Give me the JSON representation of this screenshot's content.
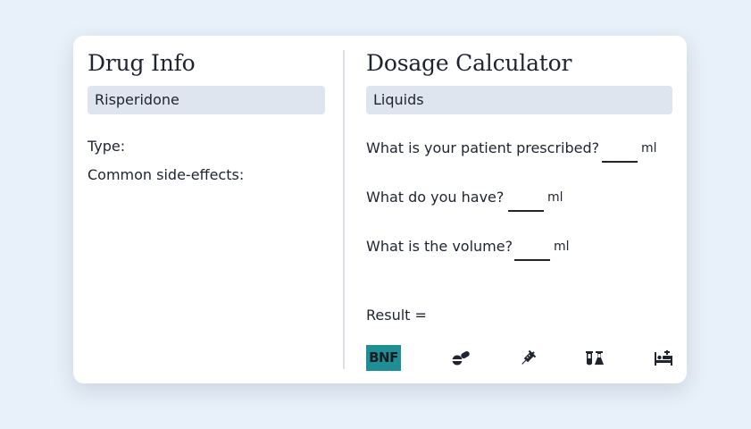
{
  "drug_info": {
    "title": "Drug Info",
    "drug_select": "Risperidone",
    "type_label": "Type:",
    "side_effects_label": "Common side-effects:"
  },
  "calculator": {
    "title": "Dosage Calculator",
    "form_select": "Liquids",
    "questions": [
      {
        "label": "What is your patient prescribed?",
        "unit": "ml"
      },
      {
        "label": "What do you have?",
        "unit": "ml"
      },
      {
        "label": "What is the volume?",
        "unit": "ml"
      }
    ],
    "result_label": "Result ="
  },
  "toolbar": {
    "bnf_label": "BNF",
    "icons": [
      "pills-icon",
      "syringe-icon",
      "flask-icon",
      "hospital-bed-icon"
    ]
  },
  "colors": {
    "background": "#e8f0f9",
    "card": "#ffffff",
    "select_bg": "#dfe5ee",
    "accent": "#1f8f95"
  }
}
